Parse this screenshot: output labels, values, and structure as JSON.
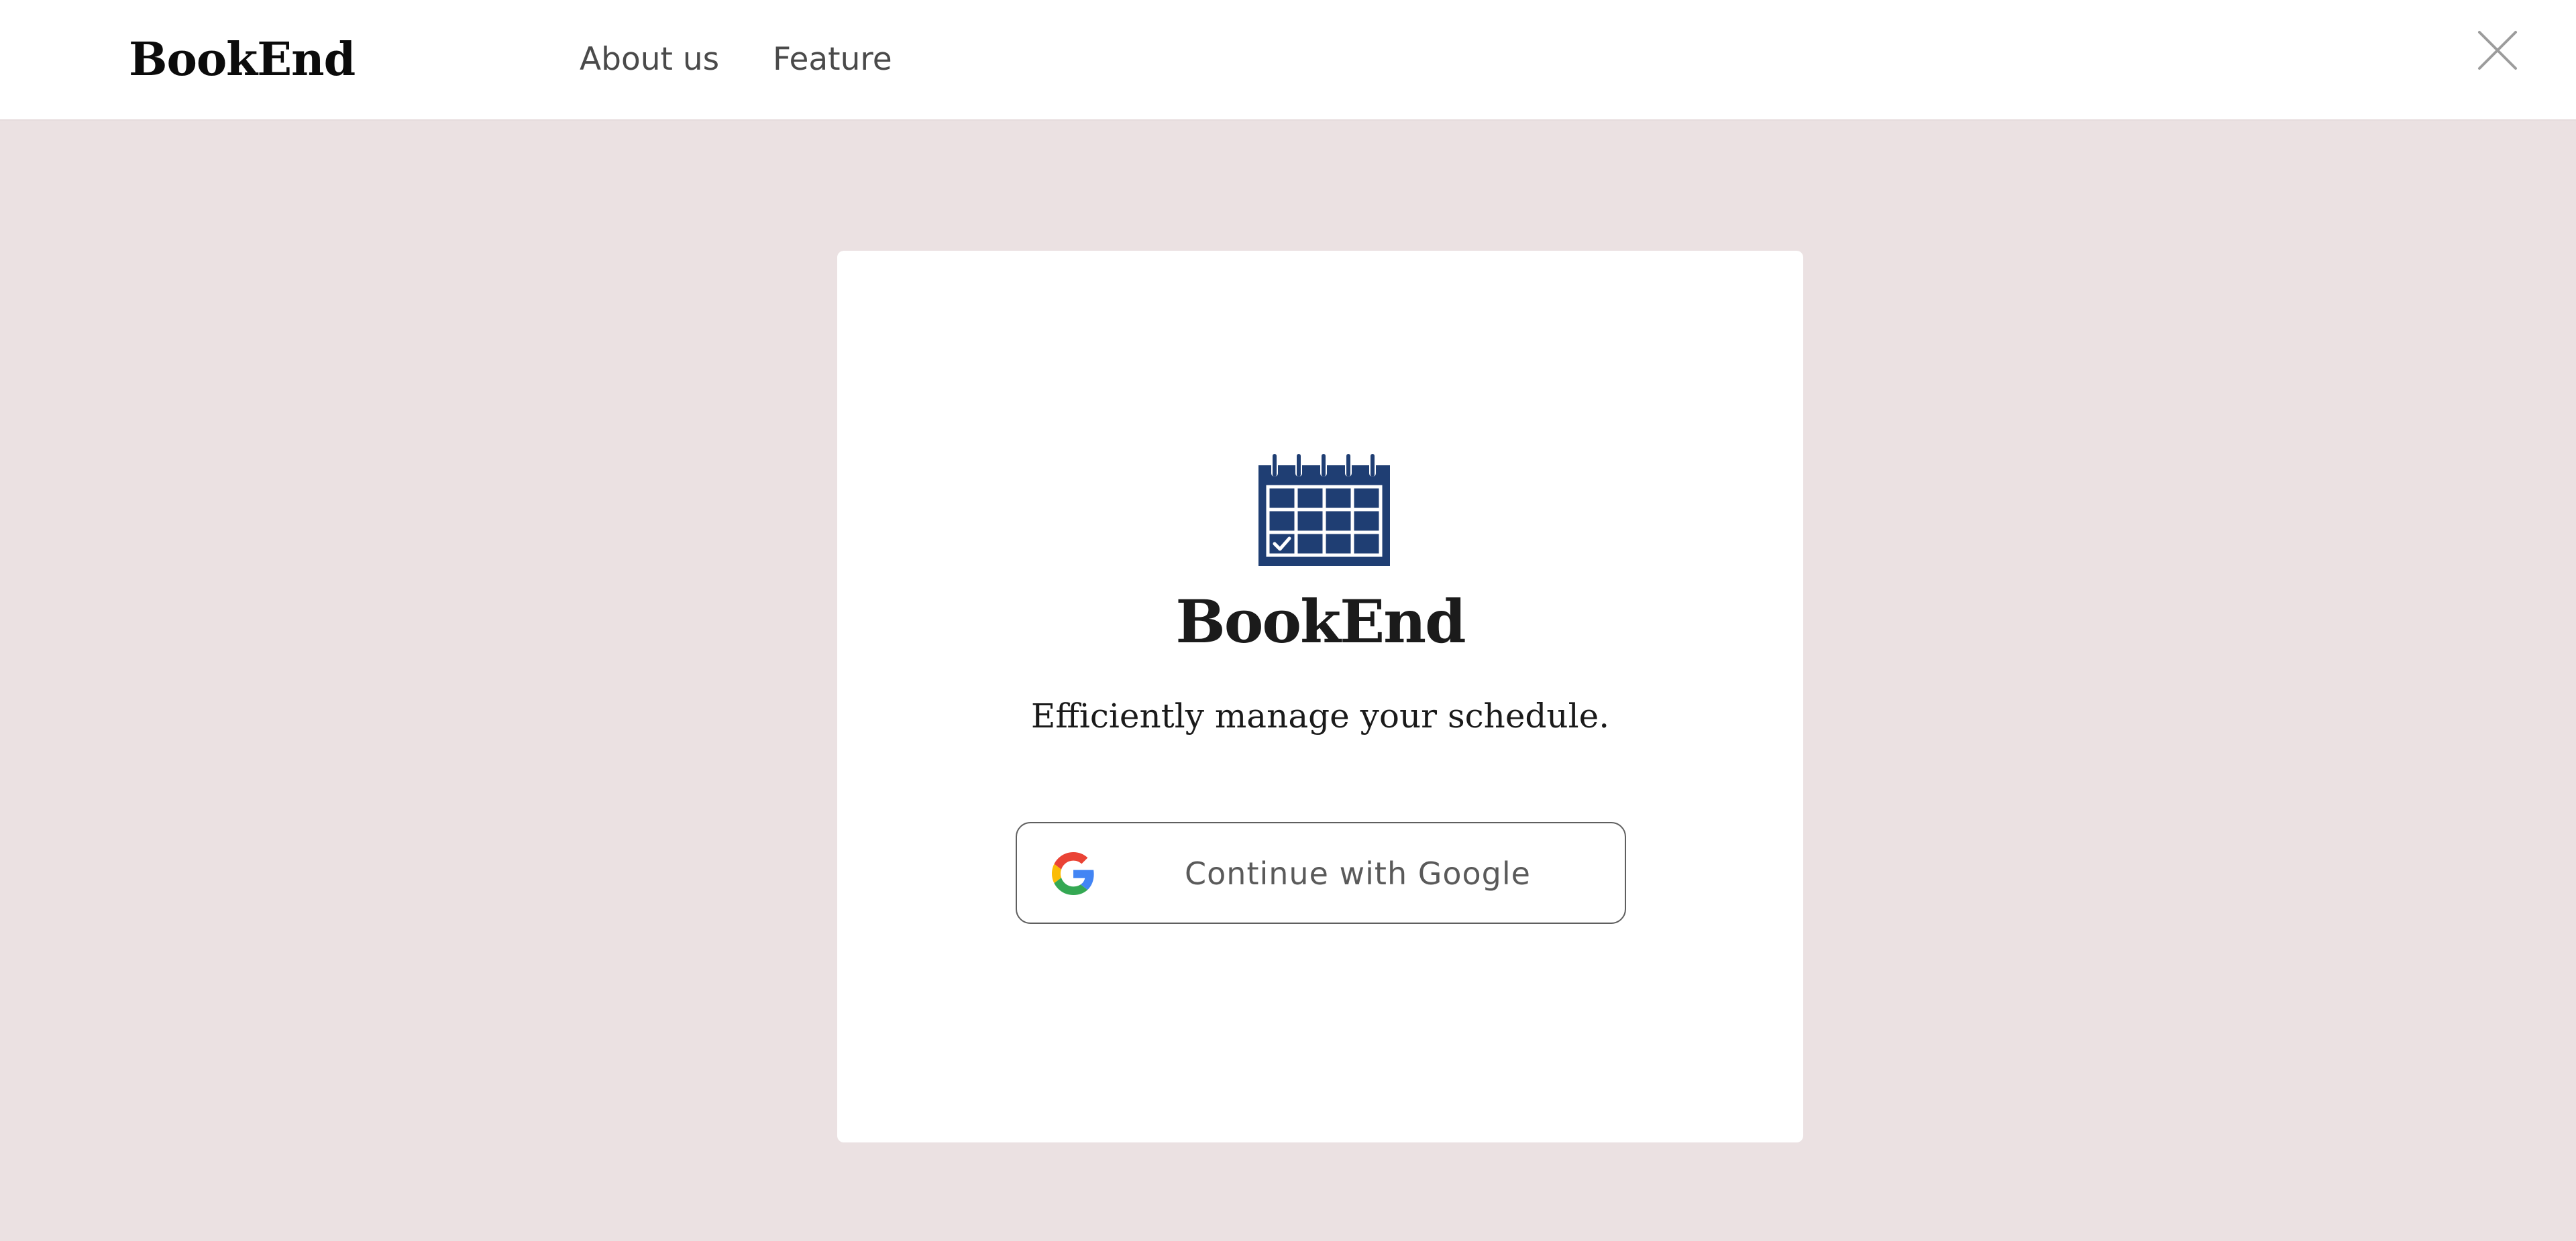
{
  "header": {
    "brand": "BookEnd",
    "nav": [
      {
        "label": "About us"
      },
      {
        "label": "Feature"
      }
    ],
    "close_icon": "close-icon"
  },
  "modal": {
    "icon": "calendar-check-icon",
    "brand": "BookEnd",
    "tagline": "Efficiently manage your schedule.",
    "google_button": {
      "icon": "google-icon",
      "label": "Continue with Google"
    }
  },
  "colors": {
    "page_background": "#ebe1e2",
    "header_background": "#ffffff",
    "calendar_icon": "#1f3e73",
    "button_border": "#5f5f5f"
  }
}
